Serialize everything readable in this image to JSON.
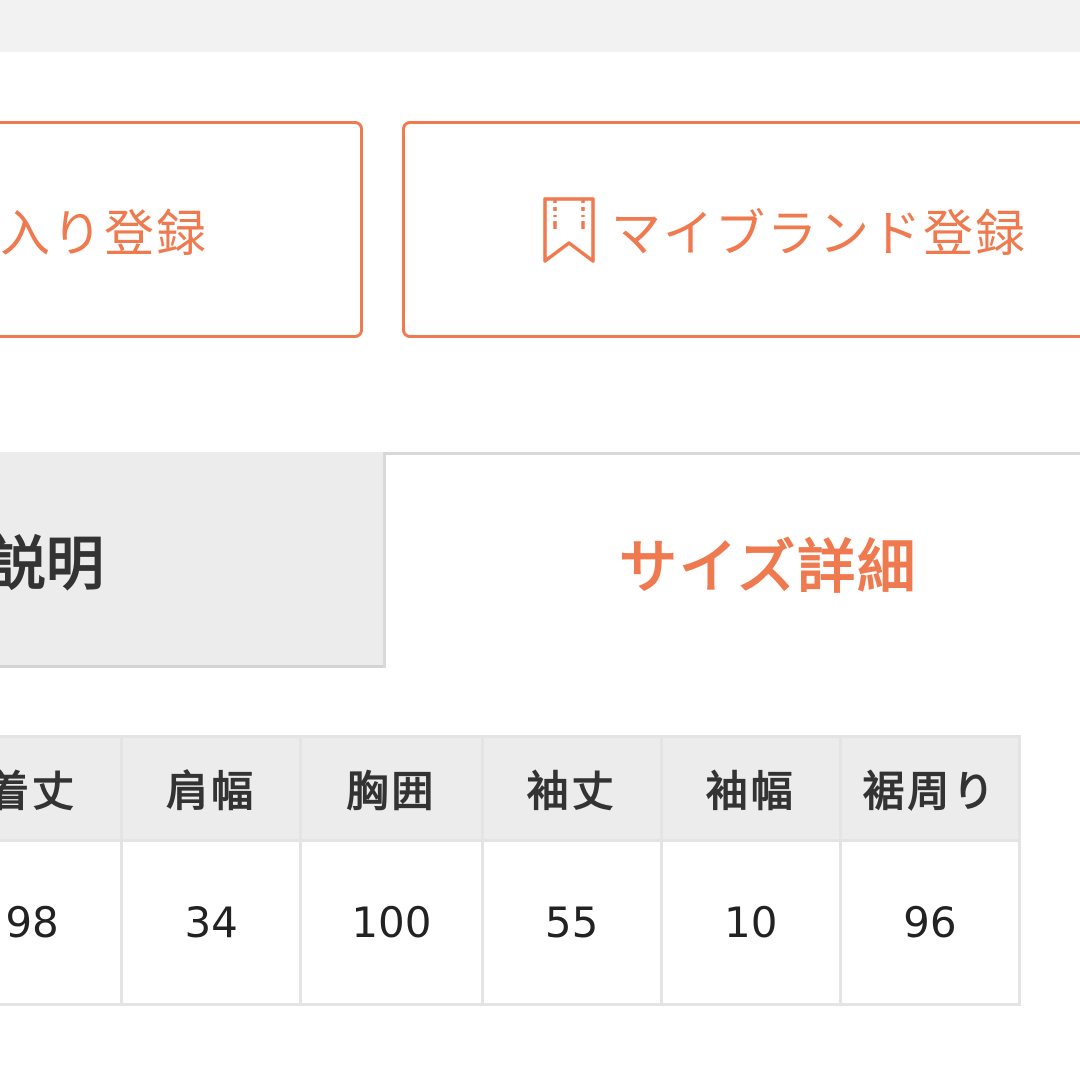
{
  "colors": {
    "accent": "#f07a4f",
    "tab_inactive_bg": "#ececec",
    "header_bg": "#ececec",
    "border": "#e4e4e4"
  },
  "actions": {
    "favorite_label": "入り登録",
    "mybrand_label": "マイブランド登録",
    "mybrand_icon": "bookmark-icon"
  },
  "tabs": {
    "description_label": "説明",
    "size_label": "サイズ詳細",
    "active": "size"
  },
  "size_table": {
    "headers": [
      "着丈",
      "肩幅",
      "胸囲",
      "袖丈",
      "袖幅",
      "裾周り"
    ],
    "values": [
      "98",
      "34",
      "100",
      "55",
      "10",
      "96"
    ]
  }
}
